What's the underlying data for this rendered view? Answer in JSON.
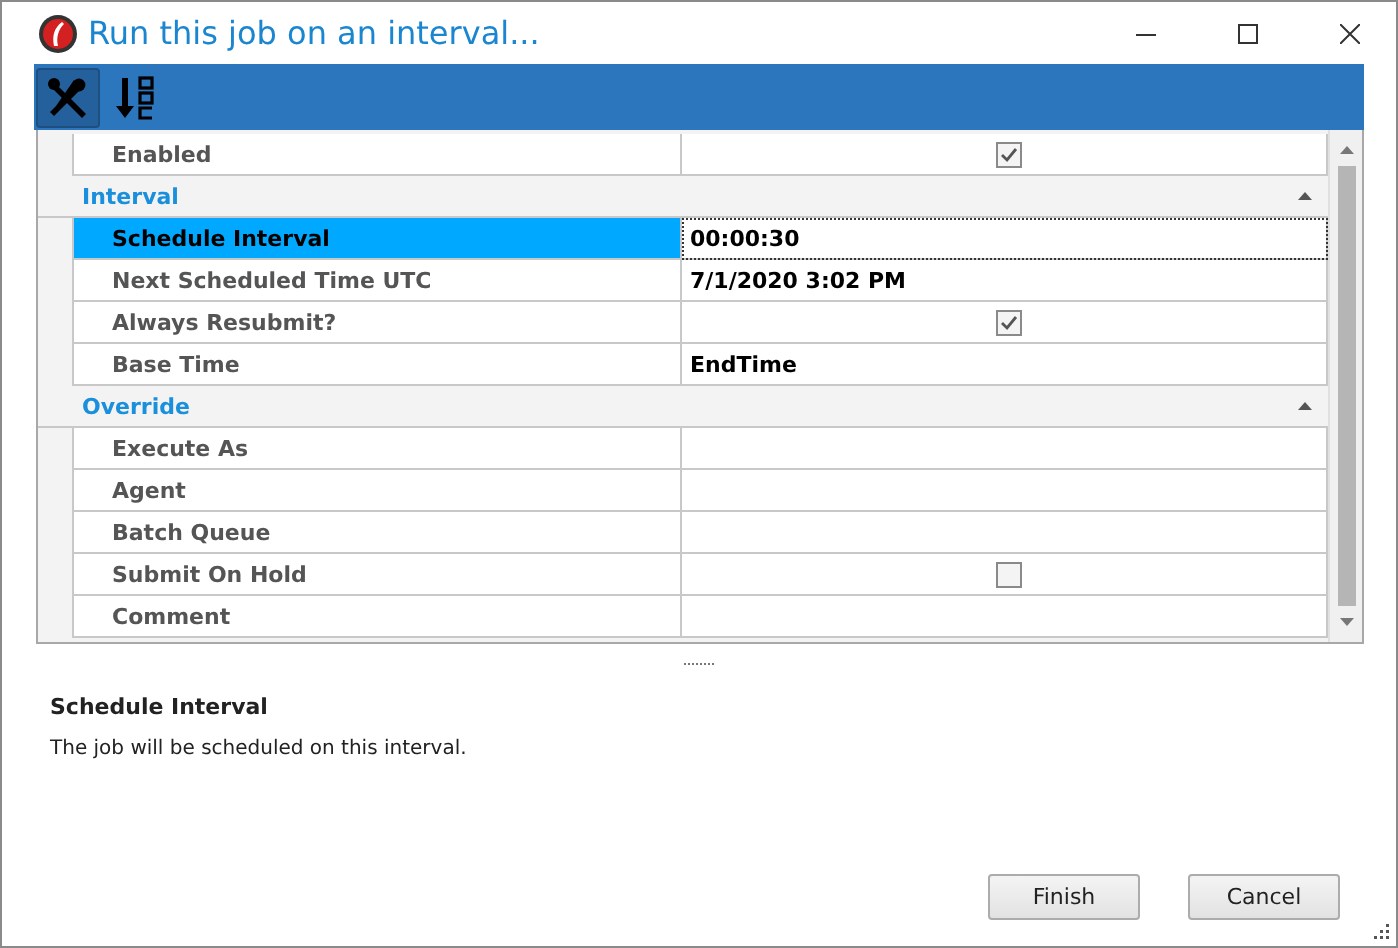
{
  "window": {
    "title": "Run this job on an interval..."
  },
  "toolbar": {
    "buttons": [
      {
        "kind": "categorized",
        "selected": true
      },
      {
        "kind": "alphabetical",
        "selected": false
      }
    ]
  },
  "grid": {
    "items": [
      {
        "kind": "checkbox",
        "label": "Enabled",
        "checked": true,
        "selected": false
      },
      {
        "kind": "category",
        "title": "Interval",
        "expanded": true,
        "children": [
          {
            "kind": "text",
            "label": "Schedule Interval",
            "value": "00:00:30",
            "selected": true
          },
          {
            "kind": "text",
            "label": "Next Scheduled Time UTC",
            "value": "7/1/2020 3:02 PM",
            "selected": false
          },
          {
            "kind": "checkbox",
            "label": "Always Resubmit?",
            "checked": true,
            "selected": false
          },
          {
            "kind": "text",
            "label": "Base Time",
            "value": "EndTime",
            "selected": false
          }
        ]
      },
      {
        "kind": "category",
        "title": "Override",
        "expanded": true,
        "children": [
          {
            "kind": "text",
            "label": "Execute As",
            "selected": false
          },
          {
            "kind": "text",
            "label": "Agent",
            "selected": false
          },
          {
            "kind": "text",
            "label": "Batch Queue",
            "selected": false
          },
          {
            "kind": "checkbox",
            "label": "Submit On Hold",
            "checked": false,
            "selected": false
          },
          {
            "kind": "text",
            "label": "Comment",
            "selected": false
          }
        ]
      }
    ]
  },
  "description": {
    "title": "Schedule Interval",
    "text": "The job will be scheduled on this interval."
  },
  "buttons": [
    "Finish",
    "Cancel"
  ]
}
